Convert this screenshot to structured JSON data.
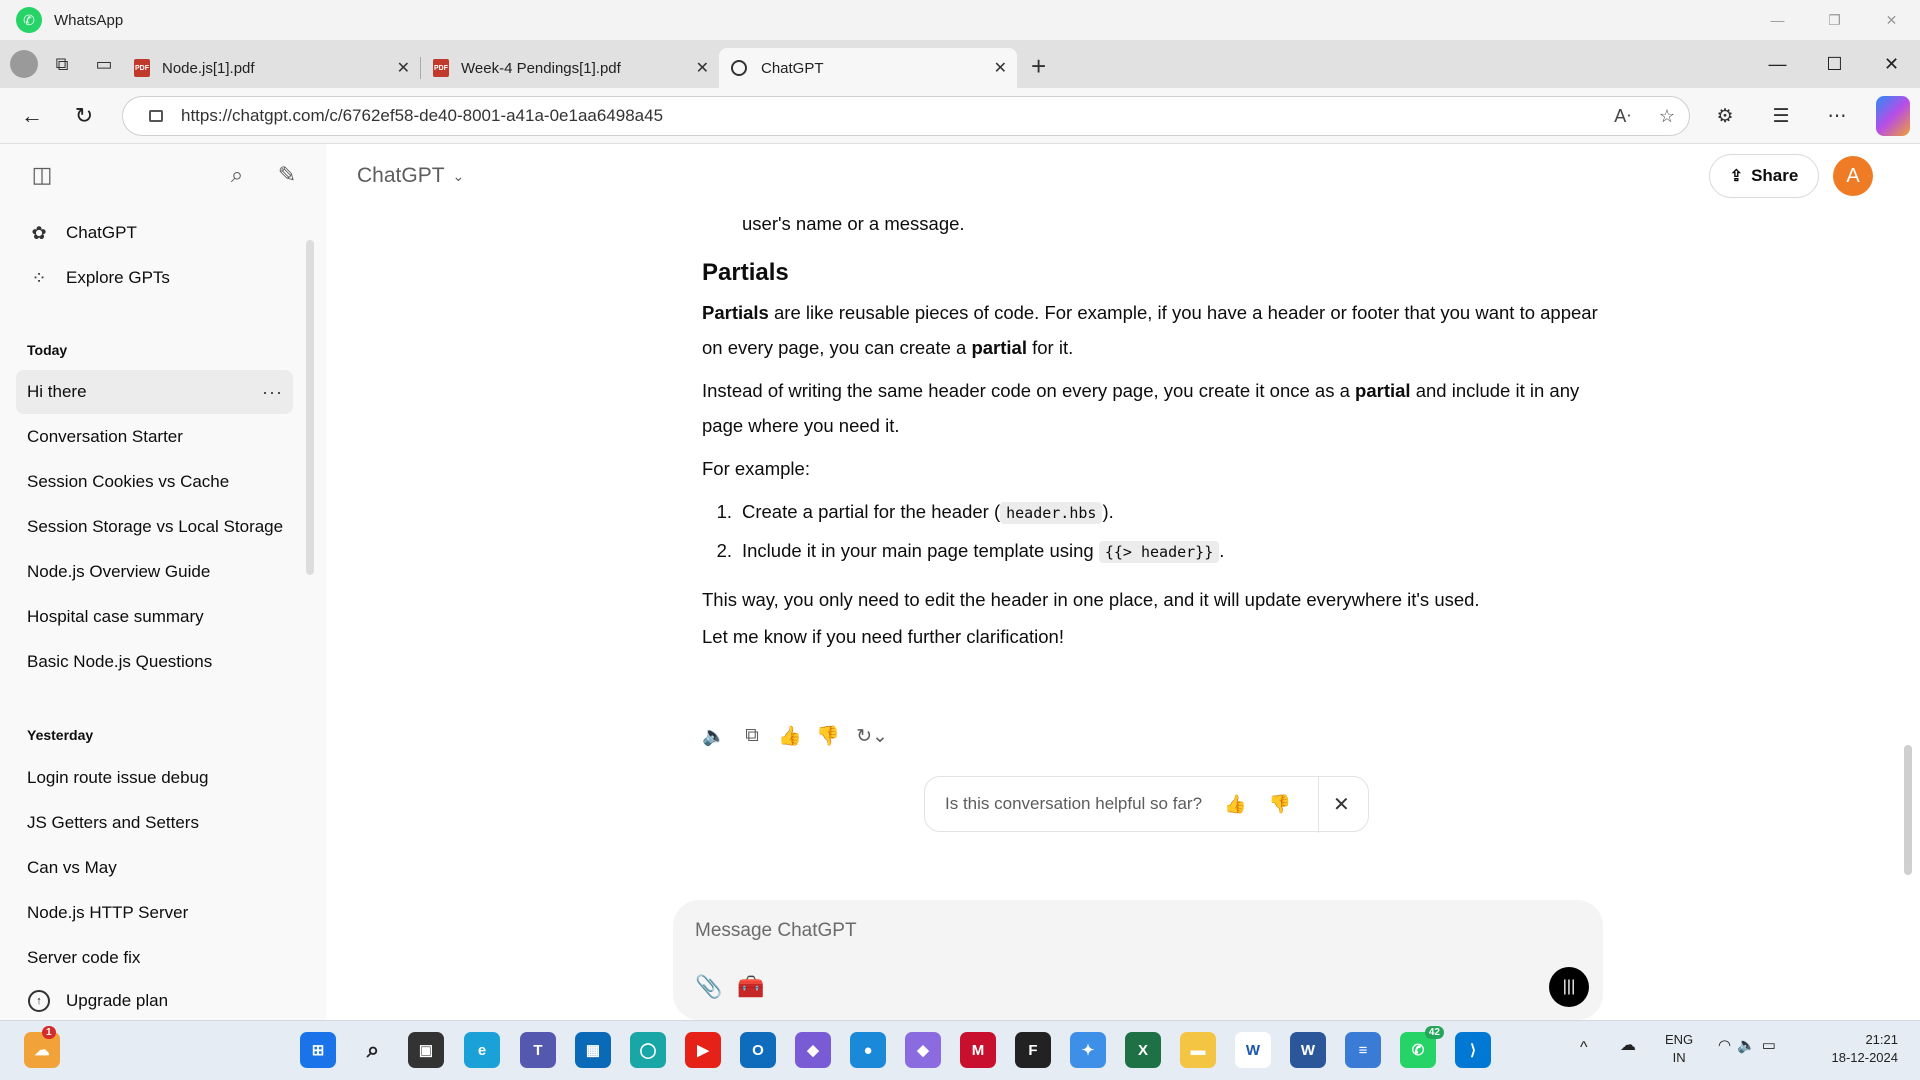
{
  "app_window": {
    "title": "WhatsApp"
  },
  "browser": {
    "tabs": [
      {
        "label": "Node.js[1].pdf",
        "type": "pdf"
      },
      {
        "label": "Week-4 Pendings[1].pdf",
        "type": "pdf"
      },
      {
        "label": "ChatGPT",
        "type": "web",
        "active": true
      }
    ],
    "url": "https://chatgpt.com/c/6762ef58-de40-8001-a41a-0e1aa6498a45"
  },
  "sidebar": {
    "links": [
      {
        "label": "ChatGPT",
        "icon": "chatgpt-logo-icon"
      },
      {
        "label": "Explore GPTs",
        "icon": "grid-icon"
      }
    ],
    "today_heading": "Today",
    "today": [
      "Hi there",
      "Conversation Starter",
      "Session Cookies vs Cache",
      "Session Storage vs Local Storage",
      "Node.js Overview Guide",
      "Hospital case summary",
      "Basic Node.js Questions"
    ],
    "yesterday_heading": "Yesterday",
    "yesterday": [
      "Login route issue debug",
      "JS Getters and Setters",
      "Can vs May",
      "Node.js HTTP Server",
      "Server code fix"
    ],
    "upgrade_label": "Upgrade plan"
  },
  "header": {
    "model": "ChatGPT",
    "share_label": "Share",
    "avatar_initial": "A",
    "avatar_color": "#ef7b24"
  },
  "conversation": {
    "prev_line": "user's name or a message.",
    "heading": "Partials",
    "p1_bold": "Partials",
    "p1_text": " are like reusable pieces of code. For example, if you have a header or footer that you want to appear on every page, you can create a ",
    "p1_bold2": "partial",
    "p1_end": " for it.",
    "p2_text": "Instead of writing the same header code on every page, you create it once as a ",
    "p2_bold": "partial",
    "p2_end": " and include it in any page where you need it.",
    "p3": "For example:",
    "list": [
      {
        "num": "1.",
        "text": "Create a partial for the header (",
        "code": "header.hbs",
        "end": ")."
      },
      {
        "num": "2.",
        "text": "Include it in your main page template using ",
        "code": "{{> header}}",
        "end": "."
      }
    ],
    "p4": "This way, you only need to edit the header in one place, and it will update everywhere it's used.",
    "p5": "Let me know if you need further clarification!"
  },
  "feedback": {
    "question": "Is this conversation helpful so far?"
  },
  "composer": {
    "placeholder": "Message ChatGPT"
  },
  "taskbar": {
    "widgets_badge": "1",
    "whatsapp_badge": "42",
    "lang": "ENG",
    "region": "IN",
    "time": "21:21",
    "date": "18-12-2024"
  }
}
